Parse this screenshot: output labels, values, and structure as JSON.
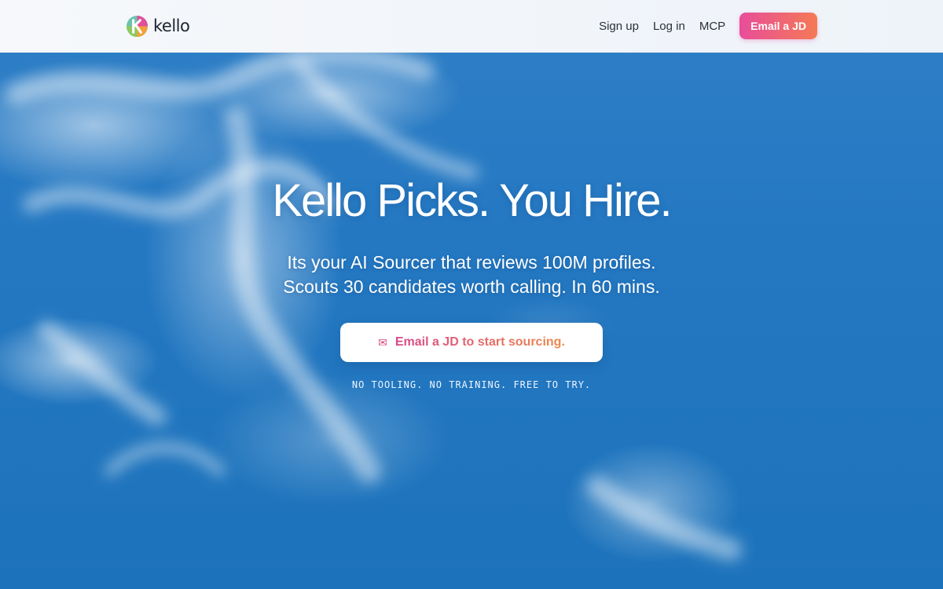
{
  "brand": {
    "name": "kello"
  },
  "nav": {
    "links": [
      "Sign up",
      "Log in",
      "MCP"
    ],
    "cta_label": "Email a JD"
  },
  "hero": {
    "headline": "Kello Picks. You Hire.",
    "subline_1": "Its your AI Sourcer that reviews 100M profiles.",
    "subline_2": "Scouts 30 candidates worth calling. In 60 mins.",
    "cta_icon": "mail-icon",
    "cta_label": "Email a JD to start sourcing.",
    "tagline": "NO TOOLING. NO TRAINING. FREE TO TRY."
  },
  "colors": {
    "sky": "#1f74bd",
    "cta_gradient_start": "#e84d9a",
    "cta_gradient_end": "#f47a55"
  }
}
